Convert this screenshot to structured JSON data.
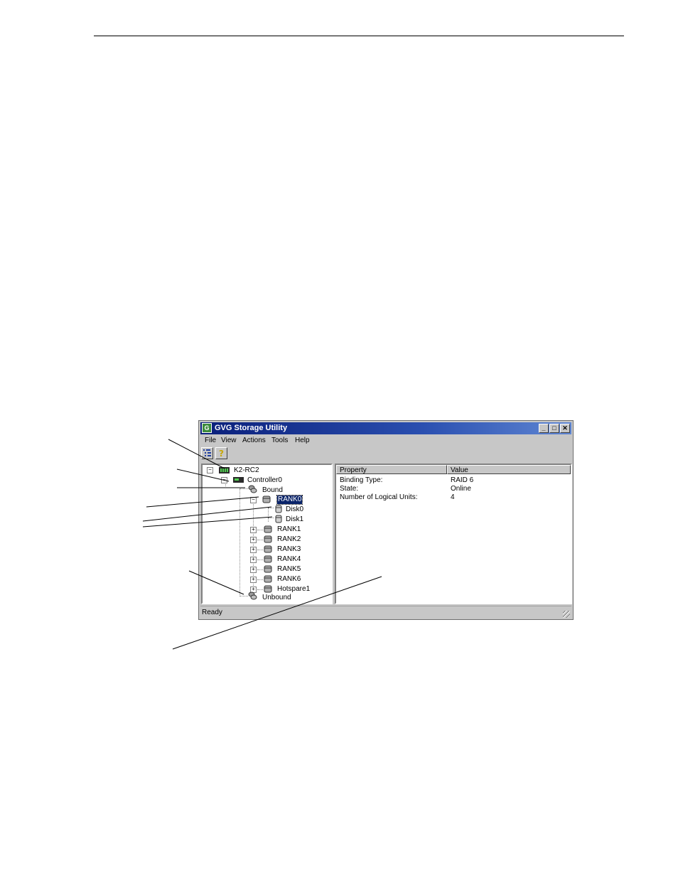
{
  "window": {
    "title": "GVG Storage Utility",
    "app_icon_glyph": "G"
  },
  "menu": [
    "File",
    "View",
    "Actions",
    "Tools",
    "Help"
  ],
  "tree": {
    "root": "K2-RC2",
    "controller": "Controller0",
    "bound": "Bound",
    "selected": "RANK0",
    "disks": [
      "Disk0",
      "Disk1"
    ],
    "ranks": [
      "RANK1",
      "RANK2",
      "RANK3",
      "RANK4",
      "RANK5",
      "RANK6",
      "Hotspare1"
    ],
    "unbound": "Unbound"
  },
  "details": {
    "columns": [
      "Property",
      "Value"
    ],
    "rows": [
      {
        "property": "Binding Type:",
        "value": "RAID 6"
      },
      {
        "property": "State:",
        "value": "Online"
      },
      {
        "property": "Number of Logical Units:",
        "value": "4"
      }
    ]
  },
  "status": "Ready",
  "icons": {
    "app": "app-icon",
    "tree_view_button": "tree-view-icon",
    "help_button": "help-question-icon",
    "minimize": "minimize-icon",
    "maximize": "maximize-icon",
    "close": "close-icon"
  }
}
